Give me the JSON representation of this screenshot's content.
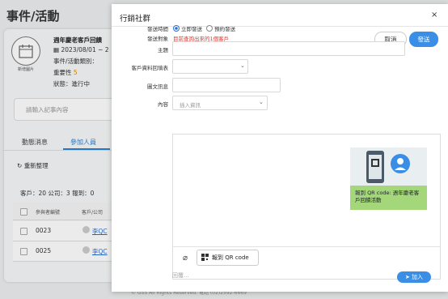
{
  "page": {
    "title": "事件/活動"
  },
  "event": {
    "icon_label": "新增圖片",
    "title": "週年慶老客戶回饋",
    "date_range": "2023/08/01 ~ 2",
    "category_label": "事件/活動類別：",
    "importance_label": "重要性",
    "importance_value": "5",
    "status": "狀態：進行中"
  },
  "note": {
    "placeholder": "請輸入記事內容"
  },
  "tabs": {
    "news": "動態消息",
    "participants": "參加人員"
  },
  "refresh_label": "重新整理",
  "summary": "客戶：20 公司：3 報到：0",
  "table": {
    "headers": [
      "參與者編號",
      "客戶/公司"
    ],
    "rows": [
      {
        "id": "0023",
        "customer": "李QC"
      },
      {
        "id": "0025",
        "customer": "李QC"
      }
    ]
  },
  "footer": "© GSS All Rights Reserved. 電話 (02)2592-6669",
  "modal": {
    "title": "行銷社群",
    "close": "×",
    "cancel": "取消",
    "send": "發送",
    "labels": {
      "send_time": "發送時間",
      "send_target": "發送對象",
      "subject": "主題",
      "customer_field": "客戶資料回填表",
      "image_link": "圖文訊息",
      "content": "內容"
    },
    "radio_now": "立即發送",
    "radio_schedule": "預約發送",
    "target_note": "目前查詢出來的1個客戶",
    "insert_placeholder": "插入資訊",
    "qr_card_text": "報到 QR code: 週年慶老客戶回饋活動",
    "qr_button": "報到 QR code",
    "reply_placeholder": "回覆...",
    "add_button": "加入"
  },
  "colors": {
    "primary": "#3a8ee6",
    "warning": "#d9352b",
    "qr_label_bg": "#a4d77a"
  }
}
